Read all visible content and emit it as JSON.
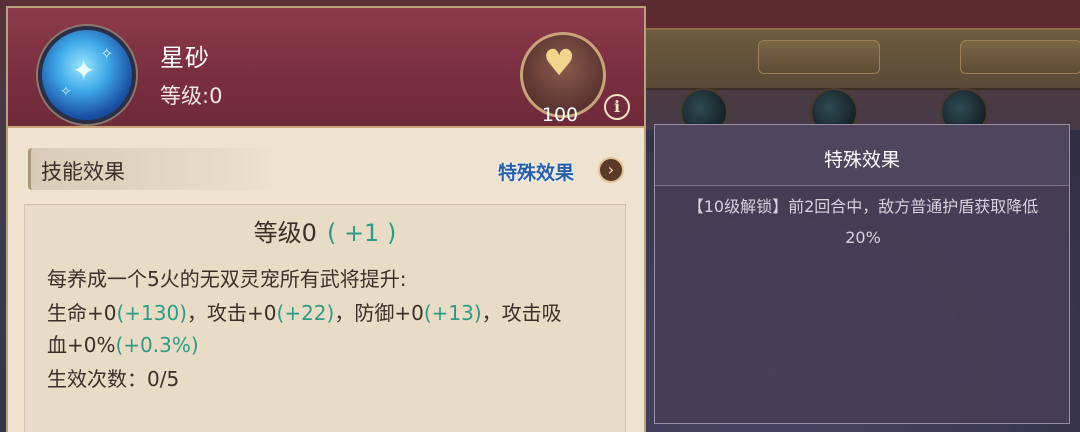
{
  "pet": {
    "name": "星砂",
    "level_text": "等级:0"
  },
  "favor": {
    "count": "100",
    "info_label": "i"
  },
  "tabs": {
    "skill_effect": "技能效果",
    "special_effect": "特殊效果",
    "arrow": "›"
  },
  "effect": {
    "level_title": "等级0",
    "level_bonus": "( +1 )",
    "line1": "每养成一个5火的无双灵宠所有武将提升:",
    "line2_a": "生命+0",
    "line2_b": "(+130)",
    "line2_c": "，攻击+0",
    "line2_d": "(+22)",
    "line2_e": "，防御+0",
    "line2_f": "(+13)",
    "line2_g": "，攻击吸",
    "line3_a": "血+0%",
    "line3_b": "(+0.3%)",
    "line4": "生效次数：0/5"
  },
  "tooltip": {
    "title": "特殊效果",
    "text": "【10级解锁】前2回合中，敌方普通护盾获取降低20%"
  },
  "colors": {
    "header": "#7a2f40",
    "panel": "#efe3cf",
    "bonus_green": "#2f9a86",
    "link_blue": "#2a5fa8",
    "tooltip_bg": "#463e56"
  }
}
